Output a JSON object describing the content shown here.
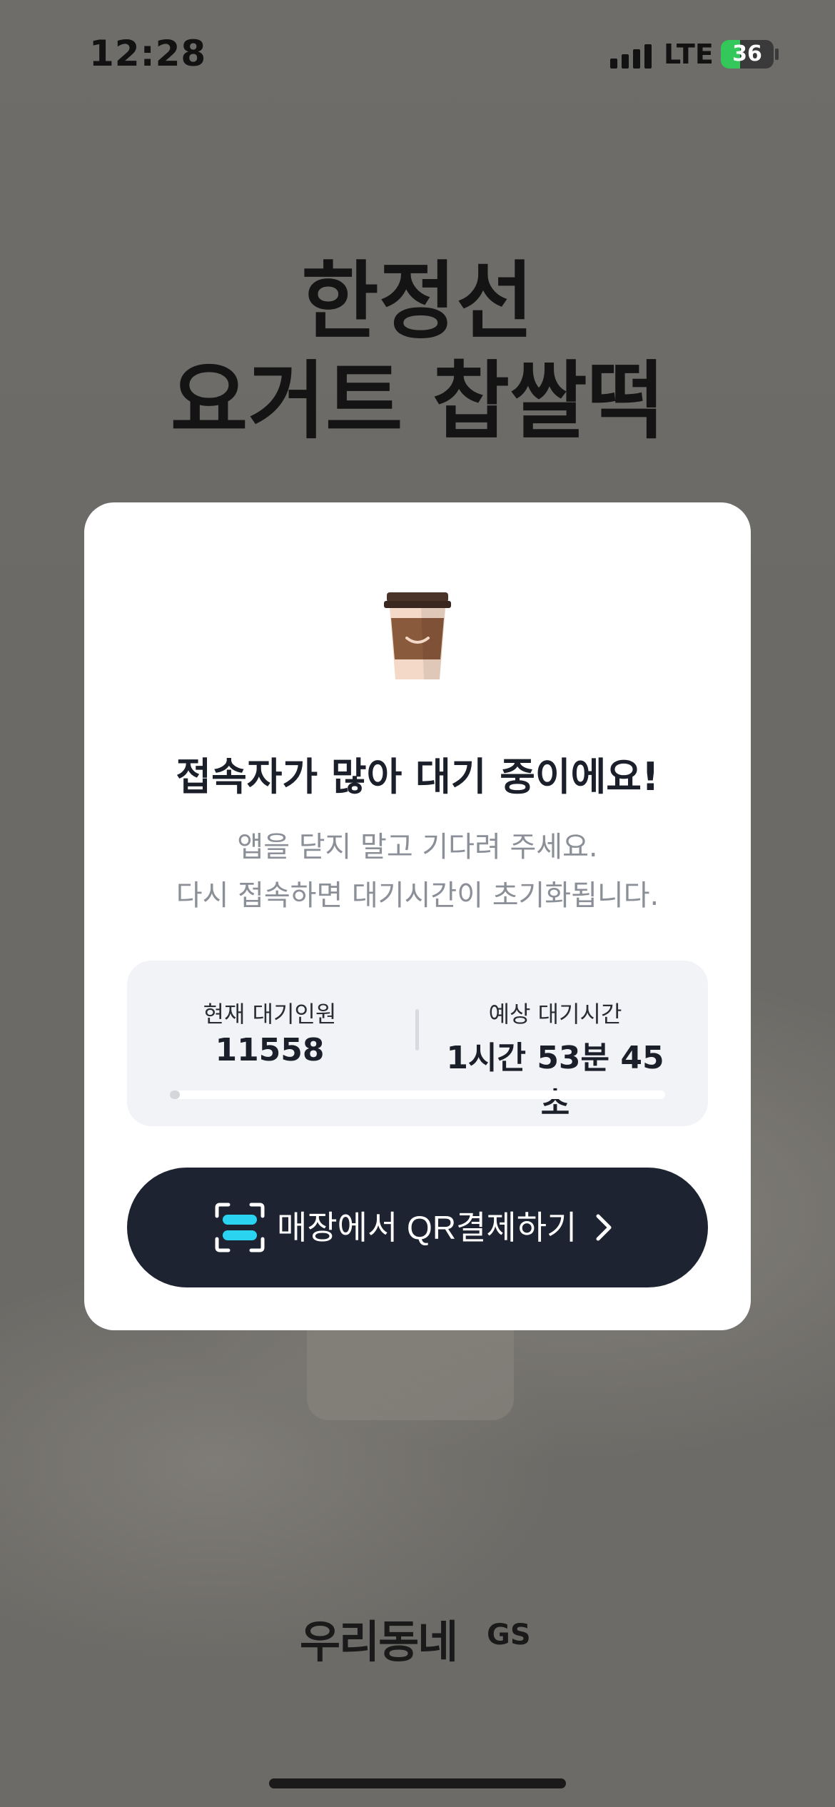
{
  "status_bar": {
    "time": "12:28",
    "network": "LTE",
    "battery": "36",
    "battery_level_percent": 36,
    "signal_bars": 4
  },
  "hero": {
    "title_line1": "한정선",
    "title_line2": "요거트 찹쌀떡"
  },
  "modal": {
    "icon": "coffee-cup-icon",
    "title": "접속자가 많아 대기 중이에요!",
    "description_line1": "앱을 닫지 말고 기다려 주세요.",
    "description_line2": "다시 접속하면 대기시간이 초기화됩니다.",
    "queue": {
      "current_label": "현재 대기인원",
      "current_value": "11558",
      "expected_label": "예상 대기시간",
      "expected_value": "1시간 53분 45초",
      "progress_fraction": 0.02
    },
    "qr_button": {
      "icon": "qr-scan-icon",
      "label": "매장에서 QR결제하기",
      "chevron": "chevron-right-icon"
    }
  },
  "footer": {
    "logo_text": "우리동네",
    "logo_suffix": "GS"
  },
  "colors": {
    "overlay_background": "#6e6c68",
    "modal_background": "#ffffff",
    "button_background": "#1e2331",
    "qr_icon_accent": "#2ad4f0",
    "battery_green": "#34c759"
  }
}
